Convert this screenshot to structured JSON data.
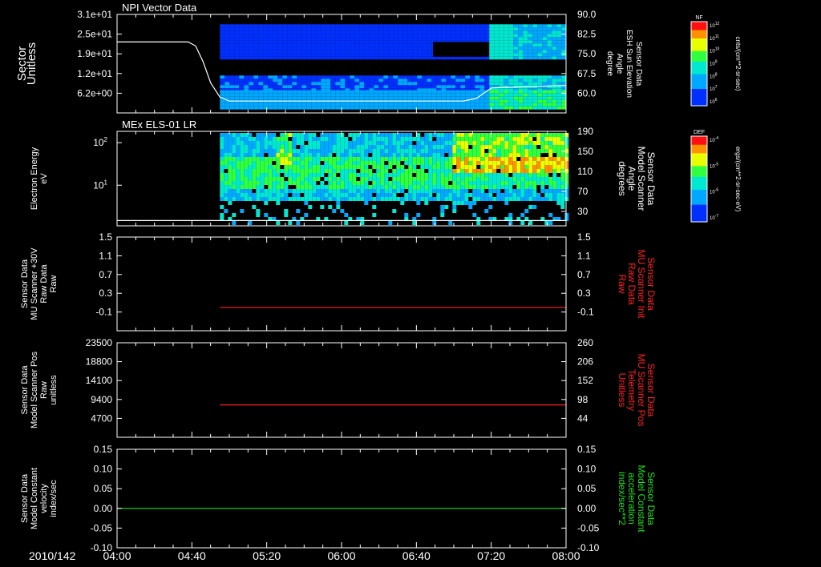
{
  "time_axis": {
    "date_label": "2010/142",
    "ticks": [
      "04:00",
      "04:40",
      "05:20",
      "06:00",
      "06:40",
      "07:20",
      "08:00"
    ],
    "range": [
      "04:00",
      "08:00"
    ]
  },
  "colorbars": [
    {
      "tag": "NF",
      "unit": "cnts/(cm**2-sr-sec)",
      "tick_labels": [
        "10^12",
        "10^11",
        "10^10",
        "10^9",
        "10^8",
        "10^7",
        "10^6"
      ]
    },
    {
      "tag": "DEF",
      "unit": "ergs/(cm**2-sr-sec-eV)",
      "tick_labels": [
        "10^-4",
        "10^-5",
        "10^-6",
        "10^-7"
      ]
    }
  ],
  "chart_data": [
    {
      "type": "heatmap",
      "title": "NPI Vector Data",
      "ylabel_lines": [
        "Sector",
        "Unitless"
      ],
      "y_ticks": [
        "3.1e+01",
        "2.5e+01",
        "1.9e+01",
        "1.2e+01",
        "6.2e+00"
      ],
      "y2label_lines": [
        "Sensor Data",
        "ESH Sun Elevation",
        "Angle",
        "degree"
      ],
      "y2_ticks": [
        "90.0",
        "82.5",
        "75.0",
        "67.5",
        "60.0"
      ],
      "y2lim": [
        52.5,
        90.0
      ],
      "data_range": [
        "04:55",
        "08:00"
      ],
      "overlay_line": {
        "name": "ESH Sun Elevation Angle",
        "color": "#ffffff",
        "x": [
          "04:00",
          "04:38",
          "04:42",
          "04:46",
          "04:50",
          "04:55",
          "05:00",
          "07:05",
          "07:12",
          "07:20",
          "07:40",
          "08:00"
        ],
        "y": [
          79.5,
          79.5,
          78.0,
          72.0,
          64.0,
          58.5,
          57.0,
          57.0,
          58.0,
          62.0,
          62.5,
          63.0
        ]
      }
    },
    {
      "type": "heatmap",
      "title": "MEx ELS-01 LR",
      "ylabel_lines": [
        "Electron Energy",
        "eV"
      ],
      "y_ticks": [
        "10^2",
        "10^1"
      ],
      "yscale": "log",
      "y2label_lines": [
        "Sensor Data",
        "Model Scanner",
        "Angle",
        "degrees"
      ],
      "y2_ticks": [
        "190",
        "150",
        "110",
        "70",
        "30"
      ],
      "y2lim": [
        10,
        190
      ],
      "data_range": [
        "04:55",
        "08:00"
      ],
      "overlay_line": {
        "name": "Model Scanner Angle",
        "color": "#ffffff",
        "x": [
          "04:00",
          "08:00"
        ],
        "y": [
          20,
          20
        ]
      }
    },
    {
      "type": "line",
      "ylabel_lines": [
        "Sensor Data",
        "MU Scanner +30V",
        "Raw Data",
        "Raw"
      ],
      "y_ticks": [
        "1.5",
        "1.1",
        "0.7",
        "0.3",
        "-0.1"
      ],
      "ylim": [
        -0.5,
        1.5
      ],
      "y2label_lines": [
        "Sensor Data",
        "MU Scanner Init",
        "Raw Data",
        "Raw"
      ],
      "y2_ticks": [
        "1.5",
        "1.1",
        "0.7",
        "0.3",
        "-0.1"
      ],
      "y2lim": [
        -0.5,
        1.5
      ],
      "series": [
        {
          "name": "MU Scanner Init Raw Data",
          "color": "#ff2020",
          "x": [
            "04:55",
            "08:00"
          ],
          "y": [
            0.0,
            0.0
          ]
        }
      ]
    },
    {
      "type": "line",
      "ylabel_lines": [
        "Sensor Data",
        "Model Scanner Pos",
        "Raw",
        "unitless"
      ],
      "y_ticks": [
        "23500",
        "18800",
        "14100",
        "9400",
        "4700"
      ],
      "ylim": [
        0,
        23500
      ],
      "y2label_lines": [
        "Sensor Data",
        "MU Scanner Pos",
        "Telemetry",
        "Unitless"
      ],
      "y2_ticks": [
        "260",
        "206",
        "152",
        "98",
        "44"
      ],
      "y2lim": [
        0,
        260
      ],
      "series": [
        {
          "name": "MU Scanner Pos Telemetry",
          "color": "#ff2020",
          "x": [
            "04:55",
            "08:00"
          ],
          "y": [
            89,
            89
          ]
        }
      ]
    },
    {
      "type": "line",
      "ylabel_lines": [
        "Sensor Data",
        "Model Constant",
        "velocity",
        "index/sec"
      ],
      "y_ticks": [
        "0.15",
        "0.10",
        "0.05",
        "0.00",
        "-0.05",
        "-0.10"
      ],
      "ylim": [
        -0.1,
        0.15
      ],
      "y2label_lines": [
        "Sensor Data",
        "Model Constant",
        "acceleration",
        "index/sec**2"
      ],
      "y2_ticks": [
        "0.15",
        "0.10",
        "0.05",
        "0.00",
        "-0.05",
        "-0.10"
      ],
      "y2lim": [
        -0.1,
        0.15
      ],
      "series": [
        {
          "name": "Model Constant acceleration",
          "color": "#20e020",
          "x": [
            "04:00",
            "08:00"
          ],
          "y": [
            0.0,
            0.0
          ]
        }
      ]
    }
  ]
}
